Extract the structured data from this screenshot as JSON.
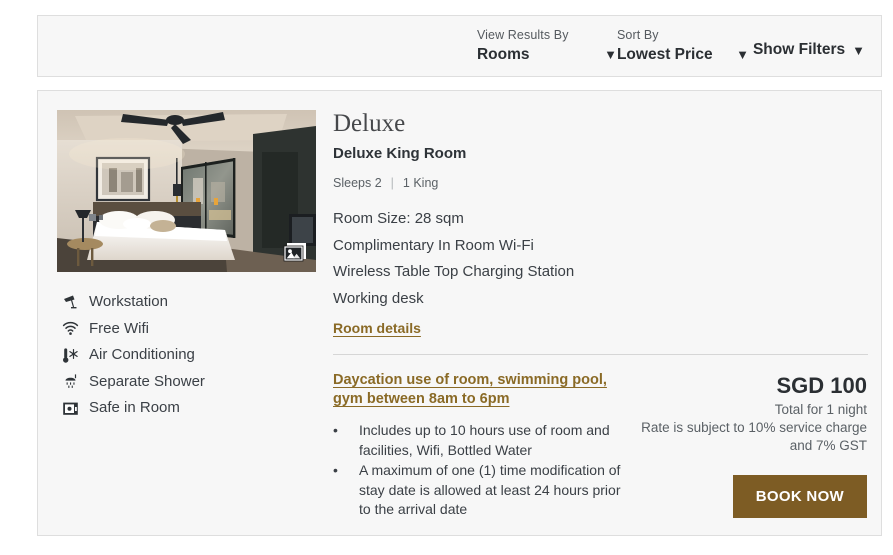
{
  "toolbar": {
    "view_results": {
      "label": "View Results By",
      "value": "Rooms",
      "caret": "▼"
    },
    "sort": {
      "label": "Sort By",
      "value": "Lowest Price",
      "caret": "▼"
    },
    "show_filters": {
      "label": "Show Filters",
      "caret": "▼"
    }
  },
  "room": {
    "type": "Deluxe",
    "name": "Deluxe King Room",
    "sleeps": "Sleeps 2",
    "separator": "|",
    "bed": "1 King",
    "features": [
      "Room Size: 28 sqm",
      "Complimentary In Room Wi-Fi",
      "Wireless Table Top Charging Station",
      "Working desk"
    ],
    "details_link": "Room details",
    "photo_badge_icon": "photo-gallery-icon",
    "amenities": [
      {
        "icon": "desk-lamp-icon",
        "label": "Workstation"
      },
      {
        "icon": "wifi-icon",
        "label": "Free Wifi"
      },
      {
        "icon": "air-conditioning-icon",
        "label": "Air Conditioning"
      },
      {
        "icon": "shower-icon",
        "label": "Separate Shower"
      },
      {
        "icon": "safe-box-icon",
        "label": "Safe in Room"
      }
    ]
  },
  "rate": {
    "title": "Daycation use of room, swimming pool, gym between 8am to 6pm",
    "bullets": [
      "Includes up to 10 hours use of room and facilities, Wifi, Bottled Water",
      "A maximum of one (1) time modification of stay date is allowed at least 24 hours prior to the arrival date"
    ],
    "bullet_marker": "•",
    "price": "SGD 100",
    "price_note": "Total for 1 night",
    "price_tax": "Rate is subject to 10% service charge and 7% GST",
    "book_label": "BOOK NOW"
  },
  "colors": {
    "link": "#8a6a26",
    "button": "#7d5c24",
    "card_bg": "#f7f7f7",
    "card_border": "#dedede",
    "text": "#3b4046"
  }
}
